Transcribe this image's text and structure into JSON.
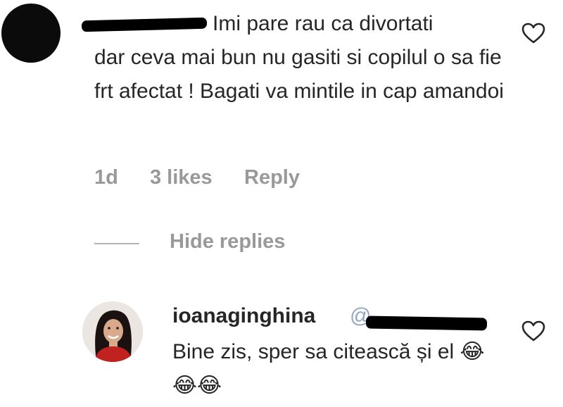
{
  "comments": [
    {
      "text_line1": "Imi pare rau ca divortati",
      "text_rest": "dar ceva mai bun nu gasiti si copilul o sa fie frt afectat ! Bagati va mintile in cap amandoi",
      "time": "1d",
      "likes": "3 likes",
      "reply_label": "Reply",
      "like_icon": "heart-outline-icon"
    }
  ],
  "replies_toggle": {
    "label": "Hide replies"
  },
  "reply": {
    "username": "ioanaginghina",
    "mention": "@",
    "text": "Bine zis, sper sa citească și el 😂😂😂",
    "like_icon": "heart-outline-icon"
  },
  "colors": {
    "text": "#262626",
    "muted": "#999999",
    "mention": "#8fa8c8"
  }
}
